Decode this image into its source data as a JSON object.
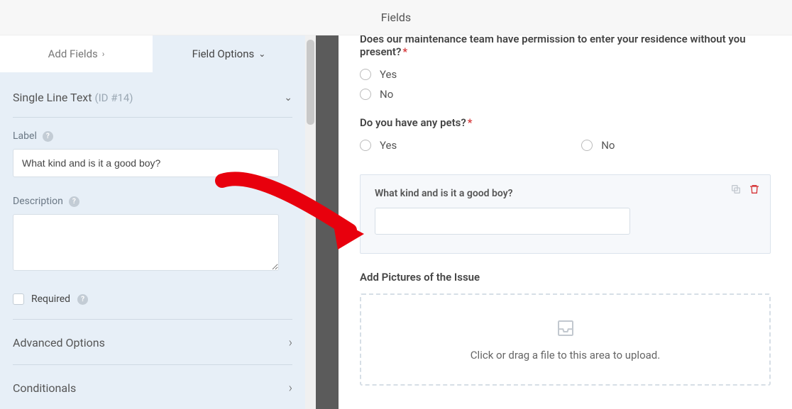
{
  "header": {
    "title": "Fields"
  },
  "tabs": {
    "addFields": "Add Fields",
    "fieldOptions": "Field Options"
  },
  "section": {
    "name": "Single Line Text",
    "idLabel": "(ID #14)"
  },
  "labels": {
    "label": "Label",
    "description": "Description",
    "required": "Required",
    "advancedOptions": "Advanced Options",
    "conditionals": "Conditionals"
  },
  "values": {
    "labelInput": "What kind and is it a good boy?"
  },
  "preview": {
    "q1": {
      "text": "Does our maintenance team have permission to enter your residence without you present?",
      "yes": "Yes",
      "no": "No"
    },
    "q2": {
      "text": "Do you have any pets?",
      "yes": "Yes",
      "no": "No"
    },
    "selected": {
      "label": "What kind and is it a good boy?"
    },
    "upload": {
      "label": "Add Pictures of the Issue",
      "hint": "Click or drag a file to this area to upload."
    }
  }
}
